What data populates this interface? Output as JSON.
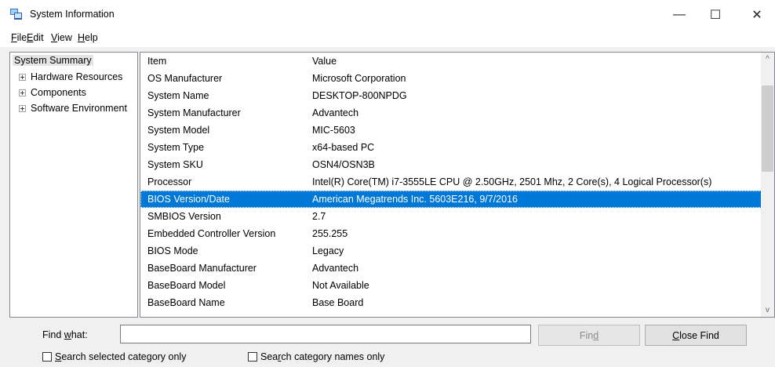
{
  "window": {
    "title": "System Information",
    "app_icon": "system-information-icon",
    "controls": {
      "minimize": "—",
      "maximize": "☐",
      "close": "✕"
    }
  },
  "menu": [
    {
      "accel": "F",
      "rest": "ile"
    },
    {
      "accel": "E",
      "rest": "dit"
    },
    {
      "accel": "V",
      "rest": "iew"
    },
    {
      "accel": "H",
      "rest": "elp"
    }
  ],
  "tree": {
    "root": "System Summary",
    "children": [
      "Hardware Resources",
      "Components",
      "Software Environment"
    ]
  },
  "list": {
    "columns": {
      "item": "Item",
      "value": "Value"
    },
    "rows": [
      {
        "item": "OS Manufacturer",
        "value": "Microsoft Corporation"
      },
      {
        "item": "System Name",
        "value": "DESKTOP-800NPDG"
      },
      {
        "item": "System Manufacturer",
        "value": "Advantech"
      },
      {
        "item": "System Model",
        "value": "MIC-5603"
      },
      {
        "item": "System Type",
        "value": "x64-based PC"
      },
      {
        "item": "System SKU",
        "value": "OSN4/OSN3B"
      },
      {
        "item": "Processor",
        "value": "Intel(R) Core(TM) i7-3555LE CPU @ 2.50GHz, 2501 Mhz, 2 Core(s), 4 Logical Processor(s)"
      },
      {
        "item": "BIOS Version/Date",
        "value": "American Megatrends Inc. 5603E216, 9/7/2016"
      },
      {
        "item": "SMBIOS Version",
        "value": "2.7"
      },
      {
        "item": "Embedded Controller Version",
        "value": "255.255"
      },
      {
        "item": "BIOS Mode",
        "value": "Legacy"
      },
      {
        "item": "BaseBoard Manufacturer",
        "value": "Advantech"
      },
      {
        "item": "BaseBoard Model",
        "value": "Not Available"
      },
      {
        "item": "BaseBoard Name",
        "value": "Base Board"
      }
    ],
    "selected_index": 7,
    "scroll_up_icon": "^",
    "scroll_down_icon": "v"
  },
  "find": {
    "label_pre": "Find ",
    "label_accel": "w",
    "label_post": "hat:",
    "value": "",
    "find_button_pre": "Fin",
    "find_button_accel": "d",
    "close_button_accel": "C",
    "close_button_rest": "lose Find",
    "search_selected": {
      "accel": "S",
      "rest": "earch selected category only",
      "checked": false
    },
    "search_names_pre": "Sea",
    "search_names_accel": "r",
    "search_names_post": "ch category names only",
    "search_names_checked": false
  }
}
